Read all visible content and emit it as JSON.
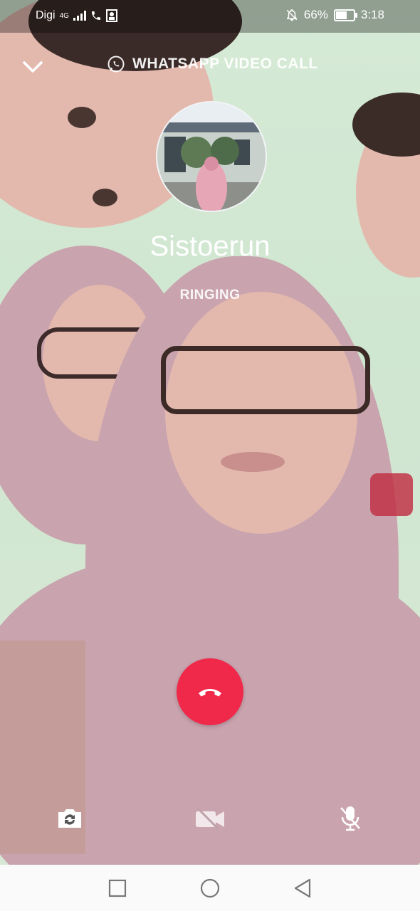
{
  "status_bar": {
    "carrier": "Digi",
    "network": "4G",
    "battery_percent": "66%",
    "battery_level": 0.66,
    "time": "3:18"
  },
  "call": {
    "type_label": "WHATSAPP VIDEO CALL",
    "caller_name": "Sistoerun",
    "status": "RINGING"
  },
  "colors": {
    "end_call": "#f0284a",
    "status_bar_bg": "rgba(0,0,0,0.32)",
    "nav_bar_bg": "#fafafa"
  },
  "icons": {
    "collapse": "chevron-down-icon",
    "whatsapp": "whatsapp-icon",
    "end_call": "phone-hangup-icon",
    "switch_camera": "switch-camera-icon",
    "video_off": "video-off-icon",
    "mute": "mic-off-icon",
    "nav_recents": "square-icon",
    "nav_home": "circle-icon",
    "nav_back": "triangle-back-icon"
  }
}
